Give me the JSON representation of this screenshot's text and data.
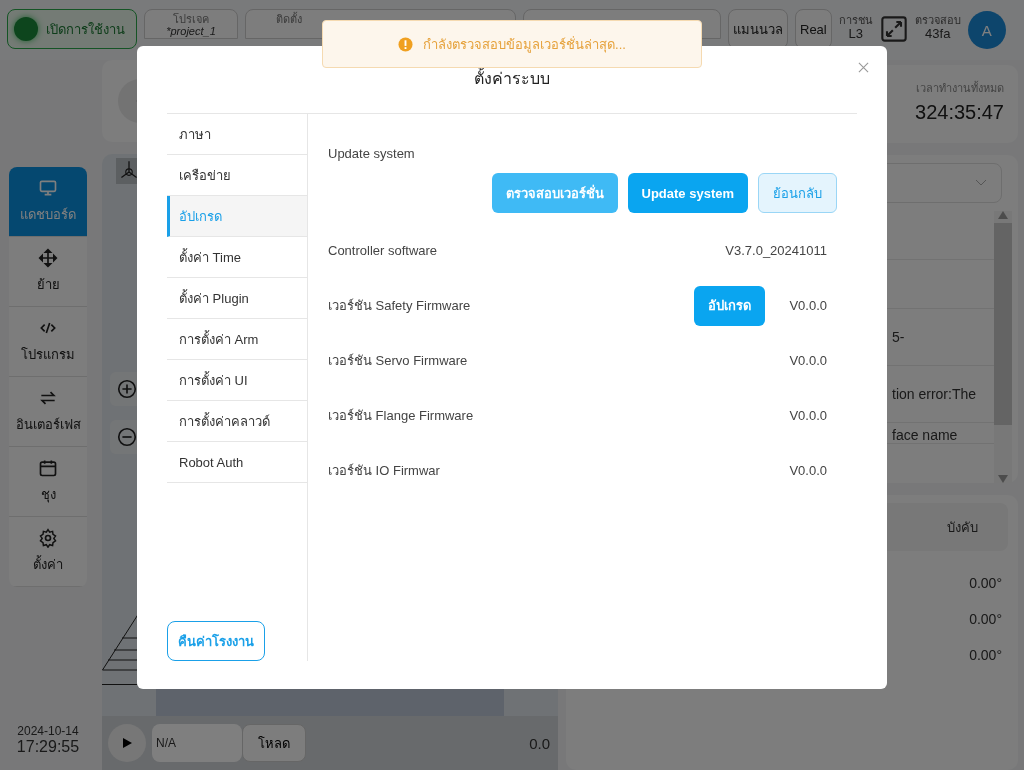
{
  "topbar": {
    "enable_button": "เปิดการใช้งาน",
    "project": {
      "label": "โปรเจค",
      "value": "*project_1"
    },
    "install": {
      "label": "ติดตั้ง"
    },
    "mode_button": "แมนนวล",
    "real_button": "Real",
    "collision": {
      "label": "การชน",
      "value": "L3"
    },
    "check": {
      "label": "ตรวจสอบ",
      "value": "43fa"
    },
    "avatar": "A"
  },
  "nav": [
    {
      "kind": "monitor",
      "label": "แดชบอร์ด",
      "selected": true
    },
    {
      "kind": "move",
      "label": "ย้าย",
      "selected": false
    },
    {
      "kind": "code",
      "label": "โปรแกรม",
      "selected": false
    },
    {
      "kind": "swap",
      "label": "อินเตอร์เฟส",
      "selected": false
    },
    {
      "kind": "calendar",
      "label": "ชุง",
      "selected": false
    },
    {
      "kind": "gear",
      "label": "ตั้งค่า",
      "selected": false
    }
  ],
  "datetime": {
    "date": "2024-10-14",
    "time": "17:29:55"
  },
  "runtime": {
    "label": "เวลาทำงานทั้งหมด",
    "value": "324:35:47"
  },
  "log_lines": [
    "5-",
    "tion error:The",
    "face name"
  ],
  "joint_panel": {
    "tab": "บังคับ",
    "values": [
      "0.00°",
      "0.00°",
      "0.00°"
    ]
  },
  "player": {
    "program": "N/A",
    "load_button": "โหลด",
    "speed": "0.0"
  },
  "toast": {
    "text": "กำลังตรวจสอบข้อมูลเวอร์ชั่นล่าสุด..."
  },
  "dialog": {
    "title": "ตั้งค่าระบบ",
    "menu": [
      {
        "label": "ภาษา",
        "selected": false
      },
      {
        "label": "เครือข่าย",
        "selected": false
      },
      {
        "label": "อัปเกรด",
        "selected": true
      },
      {
        "label": "ตั้งค่า Time",
        "selected": false
      },
      {
        "label": "ตั้งค่า Plugin",
        "selected": false
      },
      {
        "label": "การตั้งค่า Arm",
        "selected": false
      },
      {
        "label": "การตั้งค่า UI",
        "selected": false
      },
      {
        "label": "การตั้งค่าคลาวด์",
        "selected": false
      },
      {
        "label": "Robot Auth",
        "selected": false
      }
    ],
    "factory_reset_button": "คืนค่าโรงงาน",
    "section_title": "Update system",
    "actions": [
      {
        "kind": "secondary",
        "label": "ตรวจสอบเวอร์ชั่น"
      },
      {
        "kind": "primary",
        "label": "Update system"
      },
      {
        "kind": "plain",
        "label": "ย้อนกลับ"
      }
    ],
    "rows": [
      {
        "label": "Controller software",
        "value": "V3.7.0_20241011"
      },
      {
        "label": "เวอร์ชัน Safety Firmware",
        "button": "อัปเกรด",
        "value": "V0.0.0"
      },
      {
        "label": "เวอร์ชัน Servo Firmware",
        "value": "V0.0.0"
      },
      {
        "label": "เวอร์ชัน Flange Firmware",
        "value": "V0.0.0"
      },
      {
        "label": "เวอร์ชัน IO Firmwar",
        "value": "V0.0.0"
      }
    ]
  }
}
